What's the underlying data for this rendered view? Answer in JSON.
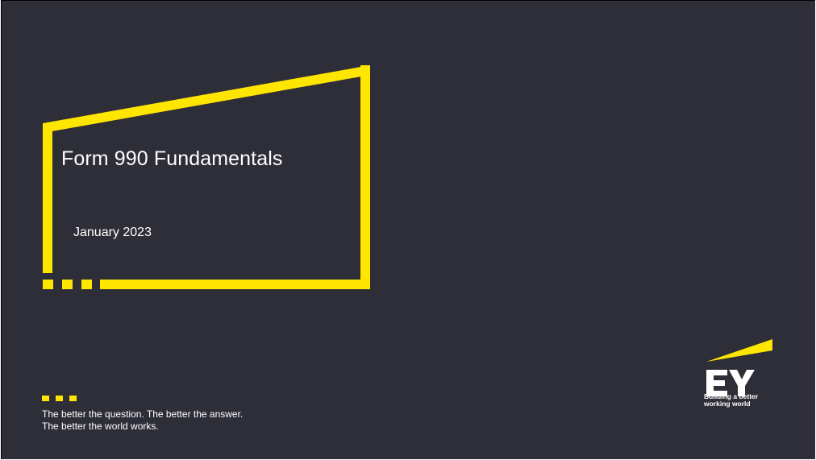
{
  "slide": {
    "title": "Form 990 Fundamentals",
    "date": "January 2023",
    "tagline": {
      "line1": "The better the question. The better the answer.",
      "line2": "The better the world works."
    },
    "logo": {
      "wordmark": "EY",
      "slogan_line1": "Building a better",
      "slogan_line2": "working world"
    }
  },
  "colors": {
    "background": "#2e2e38",
    "accent": "#ffe600",
    "text": "#ffffff"
  },
  "icons": {
    "frame": "beam-frame-icon",
    "dots": "three-dots-icon",
    "logo": "ey-logo-icon"
  }
}
